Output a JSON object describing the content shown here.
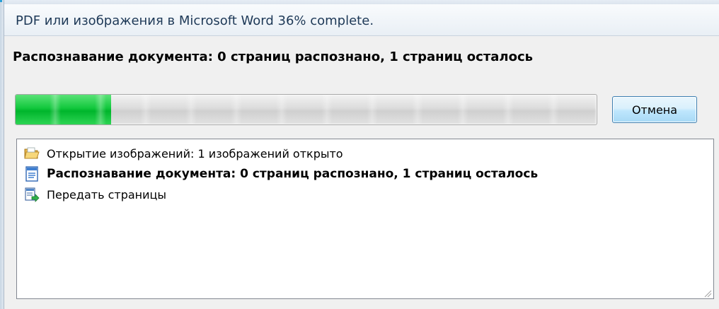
{
  "window": {
    "title": "PDF или изображения в Microsoft Word 36% complete."
  },
  "status": {
    "text": "Распознавание документа: 0 страниц распознано, 1 страниц осталось"
  },
  "progress": {
    "fraction": 0.165,
    "color": "#12c83d"
  },
  "buttons": {
    "cancel_label": "Отмена"
  },
  "log": {
    "items": [
      {
        "icon": "open-folder-icon",
        "label": "Открытие изображений: 1 изображений открыто",
        "bold": false
      },
      {
        "icon": "document-recognize-icon",
        "label": "Распознавание документа: 0 страниц распознано, 1 страниц осталось",
        "bold": true
      },
      {
        "icon": "send-pages-icon",
        "label": "Передать страницы",
        "bold": false
      }
    ]
  },
  "colors": {
    "title_text": "#1e3957",
    "button_border": "#3c7fb1",
    "window_bg": "#f0f0f0"
  }
}
